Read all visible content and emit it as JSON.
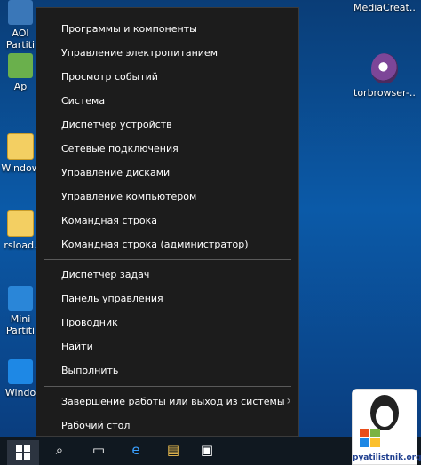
{
  "desktop": {
    "icons_left": [
      {
        "label": "AOI\nPartiti",
        "icon": "app-icon"
      },
      {
        "label": "Ap",
        "icon": "app-green-icon"
      },
      {
        "label": "Window",
        "icon": "folder-icon"
      },
      {
        "label": "rsload.",
        "icon": "folder-icon"
      },
      {
        "label": "Mini\nPartiti",
        "icon": "app-icon"
      },
      {
        "label": "Windo",
        "icon": "windows-tile-icon"
      }
    ],
    "icons_right": [
      {
        "label": "MediaCreat...",
        "icon": "media-icon"
      },
      {
        "label": "torbrowser-...",
        "icon": "tor-icon"
      }
    ]
  },
  "menu": {
    "group1": [
      "Программы и компоненты",
      "Управление электропитанием",
      "Просмотр событий",
      "Система",
      "Диспетчер устройств",
      "Сетевые подключения",
      "Управление дисками",
      "Управление компьютером",
      "Командная строка",
      "Командная строка (администратор)"
    ],
    "group2": [
      "Диспетчер задач",
      "Панель управления",
      "Проводник",
      "Найти",
      "Выполнить"
    ],
    "group3": [
      "Завершение работы или выход из системы",
      "Рабочий стол"
    ]
  },
  "watermark": {
    "text": "pyatilistnik.org"
  }
}
